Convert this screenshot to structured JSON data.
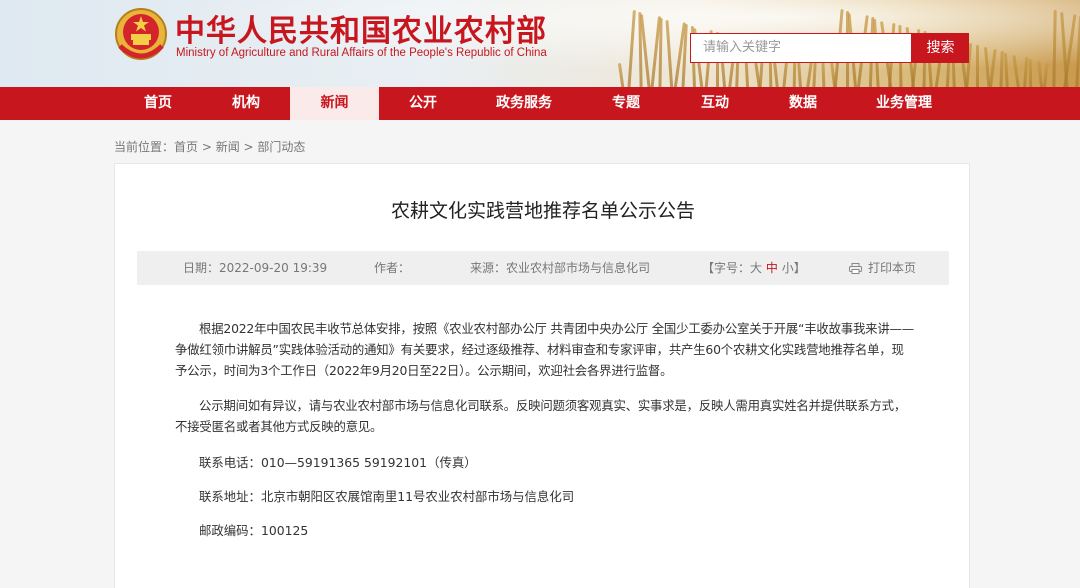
{
  "header": {
    "site_title": "中华人民共和国农业农村部",
    "site_subtitle": "Ministry of Agriculture and Rural Affairs of the People's Republic of China",
    "search_placeholder": "请输入关键字",
    "search_button": "搜索",
    "emblem_icon": "national-emblem-icon",
    "colors": {
      "brand_red": "#c8161e"
    }
  },
  "nav": {
    "items": [
      {
        "label": "首页"
      },
      {
        "label": "机构"
      },
      {
        "label": "新闻",
        "active": true
      },
      {
        "label": "公开"
      },
      {
        "label": "政务服务"
      },
      {
        "label": "专题"
      },
      {
        "label": "互动"
      },
      {
        "label": "数据"
      },
      {
        "label": "业务管理"
      }
    ]
  },
  "breadcrumb": {
    "prefix": "当前位置：",
    "items": [
      "首页",
      "新闻",
      "部门动态"
    ],
    "separator": " > "
  },
  "article": {
    "title": "农耕文化实践营地推荐名单公示公告",
    "meta": {
      "date_label": "日期：",
      "date": "2022-09-20 19:39",
      "author_label": "作者：",
      "author": "",
      "source_label": "来源：",
      "source": "农业农村部市场与信息化司",
      "font_size_label": "【字号：",
      "font_large": "大",
      "font_medium": "中",
      "font_small": "小",
      "font_size_close": "】",
      "print_label": "打印本页",
      "print_icon": "printer-icon"
    },
    "paragraphs": [
      "根据2022年中国农民丰收节总体安排，按照《农业农村部办公厅 共青团中央办公厅 全国少工委办公室关于开展“丰收故事我来讲——争做红领巾讲解员”实践体验活动的通知》有关要求，经过逐级推荐、材料审查和专家评审，共产生60个农耕文化实践营地推荐名单，现予公示，时间为3个工作日（2022年9月20日至22日）。公示期间，欢迎社会各界进行监督。",
      "公示期间如有异议，请与农业农村部市场与信息化司联系。反映问题须客观真实、实事求是，反映人需用真实姓名并提供联系方式，不接受匿名或者其他方式反映的意见。"
    ],
    "contact": {
      "phone": "联系电话：010—59191365  59192101（传真）",
      "address": "联系地址：北京市朝阳区农展馆南里11号农业农村部市场与信息化司",
      "postcode": "邮政编码：100125"
    }
  }
}
